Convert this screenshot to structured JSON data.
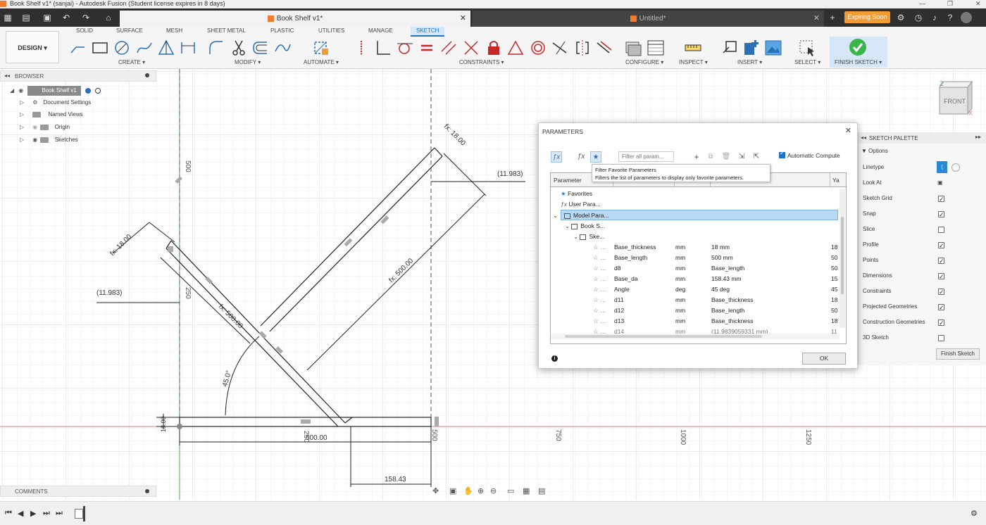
{
  "window": {
    "title": "Book Shelf v1* (sanjai) - Autodesk Fusion (Student license expires in 8 days)",
    "controls": [
      "—",
      "❐",
      "✕"
    ]
  },
  "tabs": [
    {
      "label": "Book Shelf v1*",
      "close": "✕"
    },
    {
      "label": "Untitled*",
      "close": "✕"
    }
  ],
  "header_right": {
    "expiring_label": "Expiring Soon"
  },
  "ribbon": {
    "workspace": "DESIGN ▾",
    "tabs": [
      "SOLID",
      "SURFACE",
      "MESH",
      "SHEET METAL",
      "PLASTIC",
      "UTILITIES",
      "MANAGE",
      "SKETCH"
    ],
    "active_tab": "SKETCH",
    "groups": [
      "CREATE ▾",
      "MODIFY ▾",
      "AUTOMATE ▾",
      "CONSTRAINTS ▾",
      "CONFIGURE ▾",
      "INSPECT ▾",
      "INSERT ▾",
      "SELECT ▾",
      "FINISH SKETCH ▾"
    ]
  },
  "browser": {
    "title": "BROWSER",
    "root": "Book Shelf v1",
    "items": [
      "Document Settings",
      "Named Views",
      "Origin",
      "Sketches"
    ]
  },
  "comments": {
    "title": "COMMENTS"
  },
  "viewcube": {
    "label": "FRONT",
    "axis_z": "Z",
    "axis_x": "X"
  },
  "sketch": {
    "dims": {
      "d18_right": "fx: 18.00",
      "d11983_right": "(11.983)",
      "d500_right": "fx: 500.00",
      "d18_left": "fx: 18.00",
      "d11983_left": "(11.983)",
      "d500_left": "fx: 500.00",
      "angle": "45.0°",
      "d18_base": "18.00",
      "d500_base": "500.00",
      "d158": "158.43"
    },
    "axis_marks": [
      "500",
      "250",
      "500",
      "750",
      "1000",
      "1250",
      "250"
    ]
  },
  "parameters": {
    "title": "PARAMETERS",
    "filter_placeholder": "Filter all param...",
    "auto_compute": "Automatic Compute",
    "tooltip_title": "Filter Favorite Parameters",
    "tooltip_body": "Filters the list of parameters to display only favorite parameters.",
    "columns": [
      "Parameter",
      "Ya"
    ],
    "tree": [
      "Favorites",
      "User Para...",
      "Model Para...",
      "Book S...",
      "Ske..."
    ],
    "rows": [
      {
        "name": "Base_thickness",
        "unit": "mm",
        "expr": "18 mm",
        "val": "18"
      },
      {
        "name": "Base_length",
        "unit": "mm",
        "expr": "500 mm",
        "val": "50"
      },
      {
        "name": "d8",
        "unit": "mm",
        "expr": "Base_length",
        "val": "50"
      },
      {
        "name": "Base_da",
        "unit": "mm",
        "expr": "158.43 mm",
        "val": "15"
      },
      {
        "name": "Angle",
        "unit": "deg",
        "expr": "45 deg",
        "val": "45"
      },
      {
        "name": "d11",
        "unit": "mm",
        "expr": "Base_thickness",
        "val": "18"
      },
      {
        "name": "d12",
        "unit": "mm",
        "expr": "Base_length",
        "val": "50"
      },
      {
        "name": "d13",
        "unit": "mm",
        "expr": "Base_thickness",
        "val": "18"
      },
      {
        "name": "d14",
        "unit": "mm",
        "expr": "(11.9839059331 mm)",
        "val": "11"
      }
    ],
    "ok": "OK"
  },
  "palette": {
    "title": "SKETCH PALETTE",
    "section": "Options",
    "options": [
      {
        "label": "Linetype",
        "checked": null
      },
      {
        "label": "Look At",
        "checked": null
      },
      {
        "label": "Sketch Grid",
        "checked": true
      },
      {
        "label": "Snap",
        "checked": true
      },
      {
        "label": "Slice",
        "checked": false
      },
      {
        "label": "Profile",
        "checked": true
      },
      {
        "label": "Points",
        "checked": true
      },
      {
        "label": "Dimensions",
        "checked": true
      },
      {
        "label": "Constraints",
        "checked": true
      },
      {
        "label": "Projected Geometries",
        "checked": true
      },
      {
        "label": "Construction Geometries",
        "checked": true
      },
      {
        "label": "3D Sketch",
        "checked": false
      }
    ],
    "finish": "Finish Sketch"
  }
}
